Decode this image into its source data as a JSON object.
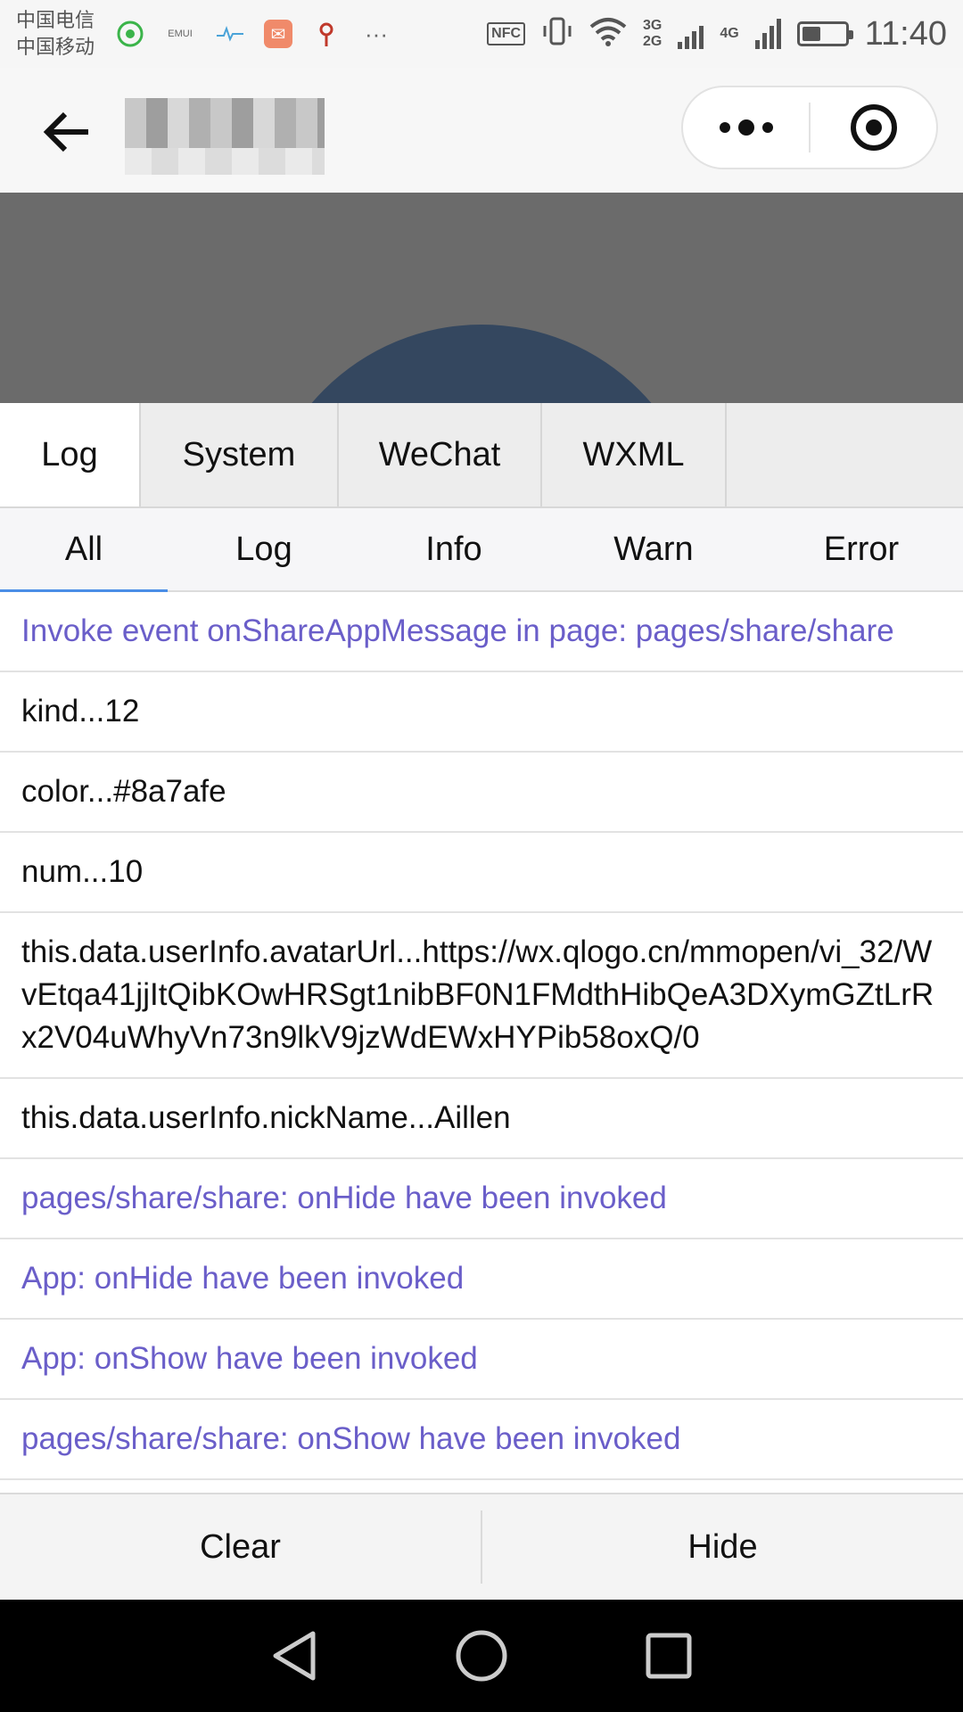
{
  "status_bar": {
    "carrier_1": "中国电信",
    "carrier_2": "中国移动",
    "notification_emui": "EMUI",
    "nfc_label": "NFC",
    "net_3g": "3G",
    "net_2g": "2G",
    "net_4g": "4G",
    "battery_level": 0.45,
    "time": "11:40"
  },
  "nav_bar": {
    "icons": [
      "back-arrow-icon",
      "more-dots-icon",
      "close-target-icon"
    ]
  },
  "console": {
    "tabs": [
      {
        "label": "Log",
        "active": true
      },
      {
        "label": "System",
        "active": false
      },
      {
        "label": "WeChat",
        "active": false
      },
      {
        "label": "WXML",
        "active": false
      }
    ],
    "filters": [
      {
        "label": "All",
        "active": true
      },
      {
        "label": "Log",
        "active": false
      },
      {
        "label": "Info",
        "active": false
      },
      {
        "label": "Warn",
        "active": false
      },
      {
        "label": "Error",
        "active": false
      }
    ],
    "entries": [
      {
        "text": "Invoke event onShareAppMessage in page: pages/share/share",
        "kind": "system"
      },
      {
        "text": "kind...12",
        "kind": "log"
      },
      {
        "text": "color...#8a7afe",
        "kind": "log"
      },
      {
        "text": "num...10",
        "kind": "log"
      },
      {
        "text": "this.data.userInfo.avatarUrl...https://wx.qlogo.cn/mmopen/vi_32/WvEtqa41jjItQibKOwHRSgt1nibBF0N1FMdthHibQeA3DXymGZtLrRx2V04uWhyVn73n9lkV9jzWdEWxHYPib58oxQ/0",
        "kind": "log"
      },
      {
        "text": "this.data.userInfo.nickName...Aillen",
        "kind": "log"
      },
      {
        "text": "pages/share/share: onHide have been invoked",
        "kind": "system"
      },
      {
        "text": "App: onHide have been invoked",
        "kind": "system"
      },
      {
        "text": "App: onShow have been invoked",
        "kind": "system"
      },
      {
        "text": "pages/share/share: onShow have been invoked",
        "kind": "system"
      }
    ],
    "clear_label": "Clear",
    "hide_label": "Hide"
  },
  "colors": {
    "system_text": "#6a5ec9",
    "active_filter_underline": "#4a8ee6",
    "page_bg": "#6b6b6b",
    "page_circle": "#34475f"
  },
  "android_nav": {
    "icons": [
      "back-triangle-icon",
      "home-circle-icon",
      "recents-square-icon"
    ]
  }
}
